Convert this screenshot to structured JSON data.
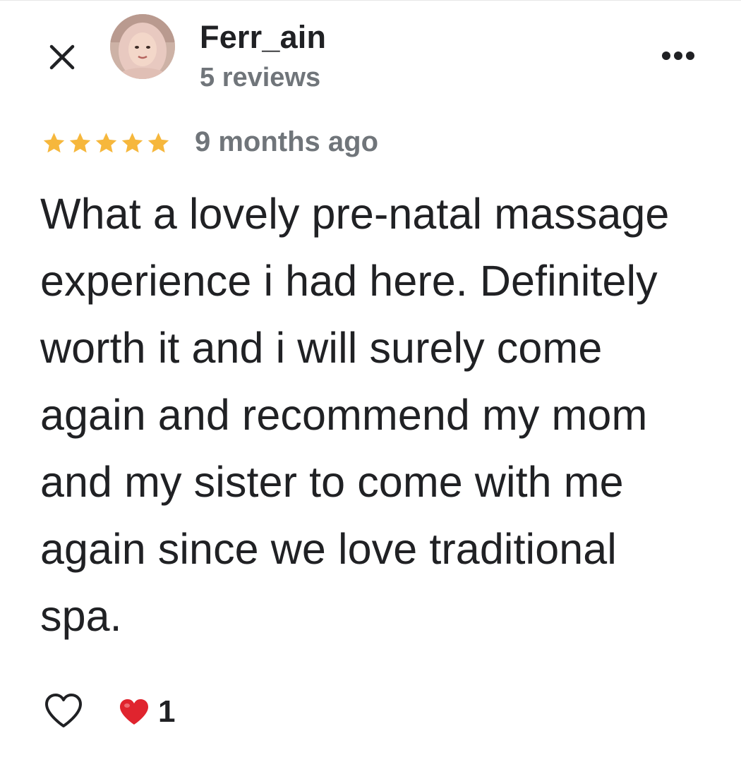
{
  "review": {
    "author_name": "Ferr_ain",
    "review_count": "5 reviews",
    "rating": 5,
    "rating_max": 5,
    "time_ago": "9 months ago",
    "text": "What a lovely pre-natal massage experience i had here. Definitely worth it and i will surely come again and recommend my mom and my sister to come with me again since we love traditional spa."
  },
  "reactions": {
    "like_icon": "heart-outline-icon",
    "reaction_icon": "red-heart-icon",
    "count": "1"
  },
  "icons": {
    "close": "close-icon",
    "more": "more-horizontal-icon",
    "star": "star-icon"
  },
  "colors": {
    "star": "#F6B73C",
    "secondary_text": "#70757A",
    "primary_text": "#202124",
    "heart_red": "#E0242E"
  }
}
